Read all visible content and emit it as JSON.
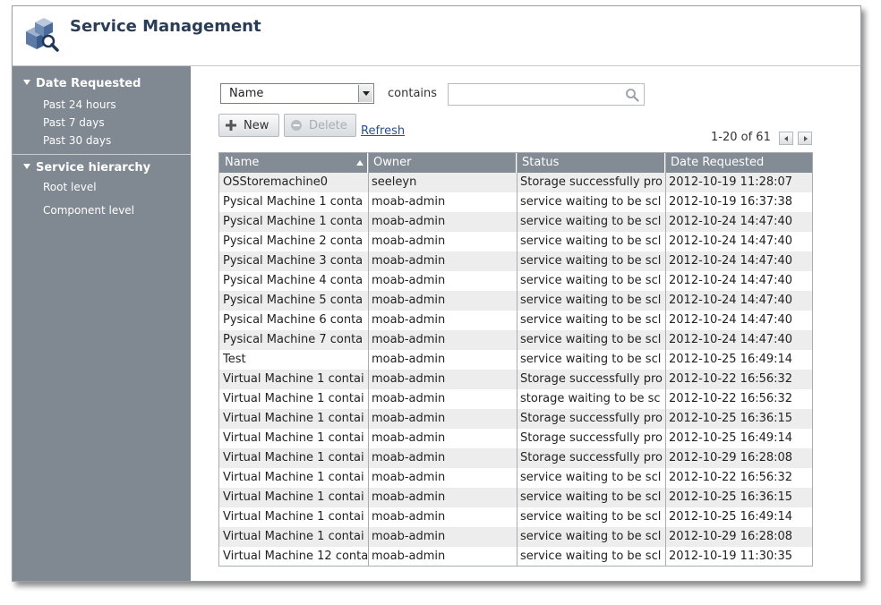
{
  "app": {
    "title": "Service Management"
  },
  "sidebar": {
    "sections": [
      {
        "label": "Date Requested",
        "items": [
          "Past 24 hours",
          "Past 7 days",
          "Past 30 days"
        ]
      },
      {
        "label": "Service hierarchy",
        "items": [
          "Root level",
          "Component level"
        ]
      }
    ]
  },
  "filter": {
    "field_value": "Name",
    "operator_label": "contains",
    "search_value": ""
  },
  "toolbar": {
    "new_label": "New",
    "delete_label": "Delete",
    "refresh_label": "Refresh"
  },
  "pager": {
    "text": "1-20 of 61"
  },
  "table": {
    "columns": [
      "Name",
      "Owner",
      "Status",
      "Date Requested"
    ],
    "rows": [
      [
        "OSStoremachine0",
        "seeleyn",
        "Storage successfully pro",
        "2012-10-19 11:28:07"
      ],
      [
        "Pysical Machine 1 conta",
        "moab-admin",
        "service waiting to be scl",
        "2012-10-19 16:37:38"
      ],
      [
        "Pysical Machine 1 conta",
        "moab-admin",
        "service waiting to be scl",
        "2012-10-24 14:47:40"
      ],
      [
        "Pysical Machine 2 conta",
        "moab-admin",
        "service waiting to be scl",
        "2012-10-24 14:47:40"
      ],
      [
        "Pysical Machine 3 conta",
        "moab-admin",
        "service waiting to be scl",
        "2012-10-24 14:47:40"
      ],
      [
        "Pysical Machine 4 conta",
        "moab-admin",
        "service waiting to be scl",
        "2012-10-24 14:47:40"
      ],
      [
        "Pysical Machine 5 conta",
        "moab-admin",
        "service waiting to be scl",
        "2012-10-24 14:47:40"
      ],
      [
        "Pysical Machine 6 conta",
        "moab-admin",
        "service waiting to be scl",
        "2012-10-24 14:47:40"
      ],
      [
        "Pysical Machine 7 conta",
        "moab-admin",
        "service waiting to be scl",
        "2012-10-24 14:47:40"
      ],
      [
        "Test",
        "moab-admin",
        "service waiting to be scl",
        "2012-10-25 16:49:14"
      ],
      [
        "Virtual Machine 1 contai",
        "moab-admin",
        "Storage successfully pro",
        "2012-10-22 16:56:32"
      ],
      [
        "Virtual Machine 1 contai",
        "moab-admin",
        "storage waiting to be sc",
        "2012-10-22 16:56:32"
      ],
      [
        "Virtual Machine 1 contai",
        "moab-admin",
        "Storage successfully pro",
        "2012-10-25 16:36:15"
      ],
      [
        "Virtual Machine 1 contai",
        "moab-admin",
        "Storage successfully pro",
        "2012-10-25 16:49:14"
      ],
      [
        "Virtual Machine 1 contai",
        "moab-admin",
        "Storage successfully pro",
        "2012-10-29 16:28:08"
      ],
      [
        "Virtual Machine 1 contai",
        "moab-admin",
        "service waiting to be scl",
        "2012-10-22 16:56:32"
      ],
      [
        "Virtual Machine 1 contai",
        "moab-admin",
        "service waiting to be scl",
        "2012-10-25 16:36:15"
      ],
      [
        "Virtual Machine 1 contai",
        "moab-admin",
        "service waiting to be scl",
        "2012-10-25 16:49:14"
      ],
      [
        "Virtual Machine 1 contai",
        "moab-admin",
        "service waiting to be scl",
        "2012-10-29 16:28:08"
      ],
      [
        "Virtual Machine 12 conta",
        "moab-admin",
        "service waiting to be scl",
        "2012-10-19 11:30:35"
      ]
    ]
  },
  "icons": {
    "app": "service-cubes-magnifier-icon",
    "search": "search-icon",
    "new": "plus-icon",
    "delete": "minus-circle-icon"
  },
  "colors": {
    "sidebar": "#808891",
    "header_text": "#2a3d57",
    "grid_header": "#838b94",
    "row_alt": "#ededee",
    "link": "#2a4f8a"
  }
}
